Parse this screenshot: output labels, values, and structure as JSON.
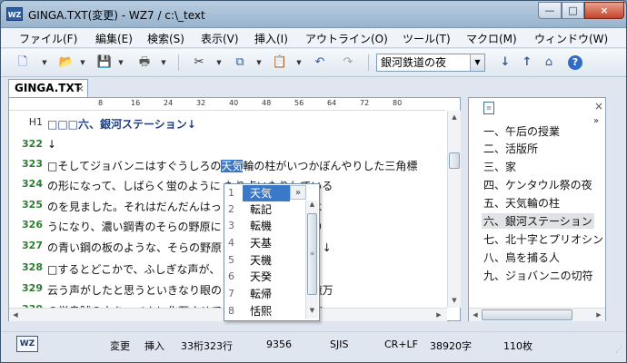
{
  "window": {
    "app_icon": "WZ",
    "title": "GINGA.TXT(変更) - WZ7 / c:\\_text",
    "controls": {
      "minimize": "—",
      "maximize": "□",
      "close": "×"
    }
  },
  "menu": [
    "ファイル(F)",
    "編集(E)",
    "検索(S)",
    "表示(V)",
    "挿入(I)",
    "アウトライン(O)",
    "ツール(T)",
    "マクロ(M)",
    "ウィンドウ(W)"
  ],
  "toolbar": {
    "icons": [
      "new-file",
      "open-folder",
      "save-disk",
      "print",
      "cut-scissors",
      "copy",
      "paste",
      "undo",
      "redo",
      "move-down",
      "move-up",
      "home",
      "help"
    ],
    "style_select": "銀河鉄道の夜"
  },
  "tab": {
    "label": "GINGA.TXT",
    "close": "×"
  },
  "ruler": [
    "8",
    "16",
    "24",
    "32",
    "40",
    "48",
    "56",
    "64",
    "72",
    "80"
  ],
  "editor": {
    "lines": [
      {
        "no": "H1",
        "text": "□□□六、銀河ステーション↓",
        "heading": true
      },
      {
        "no": "322",
        "text": "↓"
      },
      {
        "no": "323",
        "text_before": "□そしてジョバンニはすぐうしろの",
        "text_sel": "天気",
        "text_after": "輪の柱がいつかぼんやりした三角標"
      },
      {
        "no": "324",
        "text": "の形になって、しばらく蛍のように                               たり点いたりしている"
      },
      {
        "no": "325",
        "text": "のを見ました。それはだんだんはっ                               りんとうごかないよ"
      },
      {
        "no": "326",
        "text": "うになり、濃い鋼青のそらの野原に                               らしく灼いたばかり"
      },
      {
        "no": "327",
        "text": "の青い鋼の板のような、そらの野原                               っと立ったのです。↓"
      },
      {
        "no": "328",
        "text": "□するとどこかで、ふしぎな声が、                               銀河ステーションと"
      },
      {
        "no": "329",
        "text": "云う声がしたと思うといきなり眼の                               ようって、まるで億万"
      },
      {
        "no": "330",
        "text": "の蛍烏賊の火を一ぺんに化石させて                               いう工合、またダイ"
      }
    ]
  },
  "ime": {
    "more": "»",
    "candidates": [
      {
        "num": "1",
        "word": "天気"
      },
      {
        "num": "2",
        "word": "転記"
      },
      {
        "num": "3",
        "word": "転機"
      },
      {
        "num": "4",
        "word": "天基"
      },
      {
        "num": "5",
        "word": "天機"
      },
      {
        "num": "6",
        "word": "天癸"
      },
      {
        "num": "7",
        "word": "転帰"
      },
      {
        "num": "8",
        "word": "恬熙"
      }
    ],
    "scroll_grip": "≡"
  },
  "outline": {
    "close": "×",
    "more": "»",
    "items": [
      "一、午后の授業",
      "二、活版所",
      "三、家",
      "四、ケンタウル祭の夜",
      "五、天気輪の柱",
      "六、銀河ステーション",
      "七、北十字とプリオシン",
      "八、鳥を捕る人",
      "九、ジョバンニの切符"
    ],
    "active_index": 5
  },
  "status": {
    "logo": "WZ",
    "modified": "変更",
    "insert": "挿入",
    "position": "33桁323行",
    "size": "9356",
    "encoding": "SJIS",
    "newline": "CR+LF",
    "chars": "38920字",
    "pages": "110枚"
  }
}
